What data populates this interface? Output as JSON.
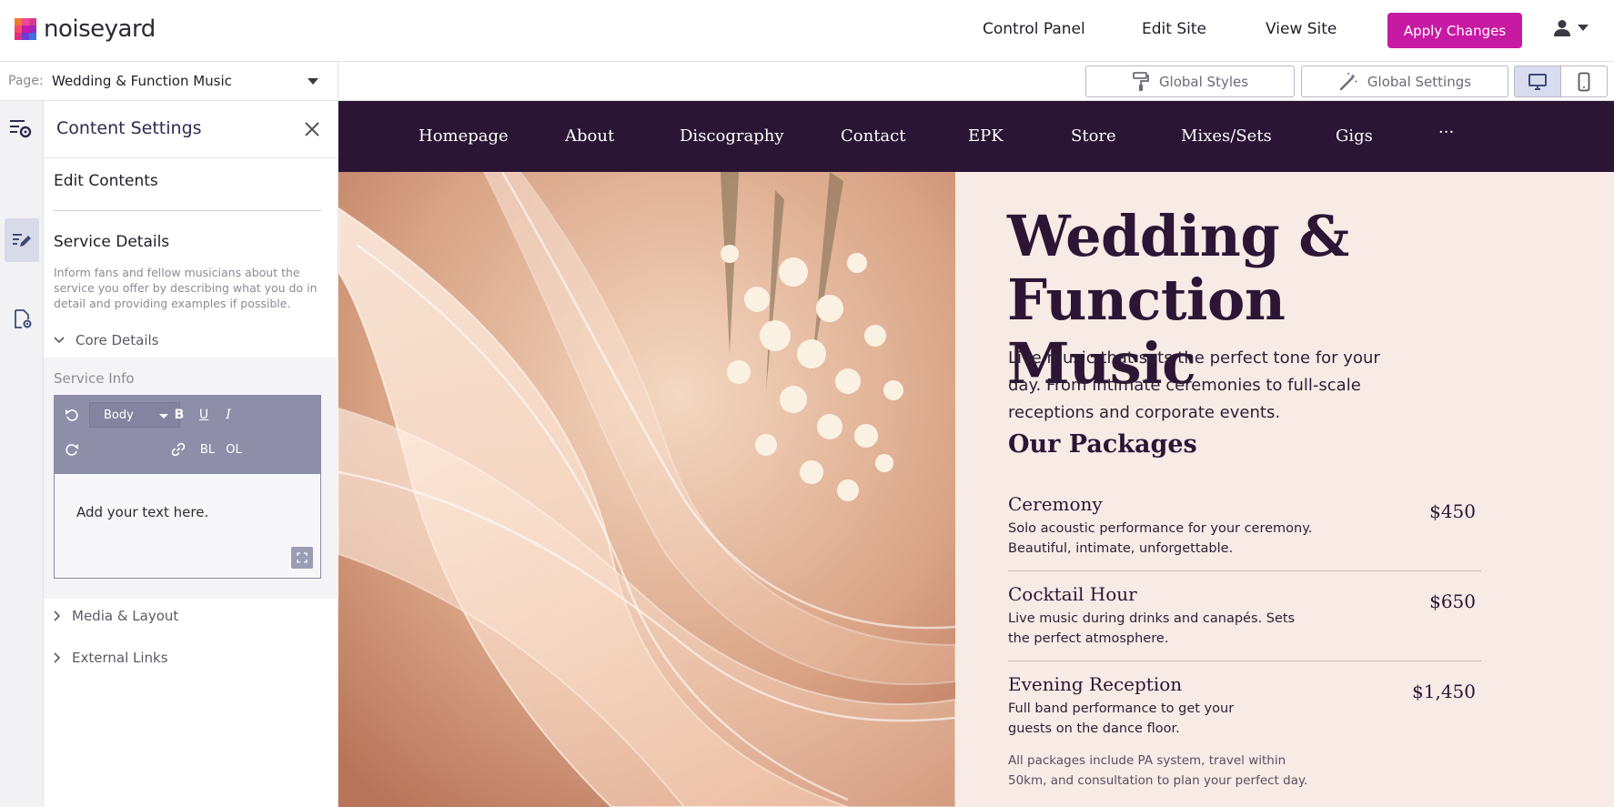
{
  "app": {
    "brand": "noiseyard",
    "nav": [
      "Control Panel",
      "Edit Site",
      "View Site"
    ],
    "apply_label": "Apply Changes"
  },
  "pagebar": {
    "label": "Page:",
    "value": "Wedding & Function Music"
  },
  "toolbar": {
    "global_styles": "Global Styles",
    "global_settings": "Global Settings",
    "active_device": "desktop"
  },
  "panel": {
    "title": "Content Settings",
    "headline": "Edit Contents",
    "section_title": "Service Details",
    "section_desc": "Inform fans and fellow musicians about the service you offer by describing what you do in detail and providing examples if possible.",
    "core_details": "Core Details",
    "service_info_label": "Service Info",
    "editor": {
      "style_select": "Body",
      "bl": "BL",
      "ol": "OL",
      "placeholder": "Add your text here."
    },
    "media_layout": "Media & Layout",
    "external_links": "External Links"
  },
  "site": {
    "nav": [
      "Homepage",
      "About",
      "Discography",
      "Contact",
      "EPK",
      "Store",
      "Mixes/Sets",
      "Gigs",
      "···"
    ],
    "title": "Wedding & Function Music",
    "intro": "Live music that sets the perfect tone for your day. From intimate ceremonies to full-scale receptions and corporate events.",
    "packages_heading": "Our Packages",
    "packages": [
      {
        "name": "Ceremony",
        "desc": "Solo acoustic performance for your ceremony. Beautiful, intimate, unforgettable.",
        "price": "$450"
      },
      {
        "name": "Cocktail Hour",
        "desc": "Live music during drinks and canapés. Sets the perfect atmosphere.",
        "price": "$650"
      },
      {
        "name": "Evening Reception",
        "desc": "Full band performance to get your guests on the dance floor.",
        "price": "$1,450"
      }
    ],
    "note": "All packages include PA system, travel within 50km, and consultation to plan your perfect day."
  },
  "colors": {
    "accent": "#c71aa3",
    "site_nav": "#2b1535",
    "content_bg": "#f8eae5",
    "editor_toolbar": "#8e8ea9"
  },
  "icons": {
    "rail": [
      "list-icon",
      "edit-content-icon",
      "page-settings-icon"
    ],
    "header": [
      "content-settings-icon",
      "close-icon",
      "user-icon",
      "caret-down-icon"
    ]
  }
}
